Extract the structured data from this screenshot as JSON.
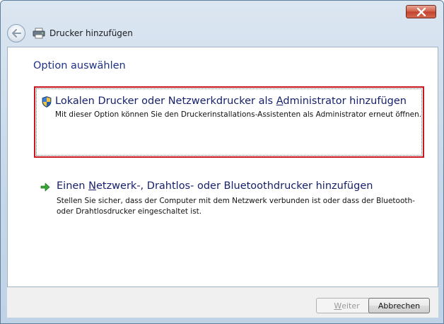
{
  "window": {
    "title": "Drucker hinzufügen"
  },
  "page": {
    "heading": "Option auswählen"
  },
  "options": [
    {
      "title_pre": "Lokalen Drucker oder Netzwerkdrucker als ",
      "title_accel": "A",
      "title_post": "dministrator hinzufügen",
      "description": "Mit dieser Option können Sie den Druckerinstallations-Assistenten als Administrator erneut öffnen.",
      "icon": "uac-shield-icon"
    },
    {
      "title_pre": "Einen ",
      "title_accel": "N",
      "title_post": "etzwerk-, Drahtlos- oder Bluetoothdrucker hinzufügen",
      "description": "Stellen Sie sicher, dass der Computer mit dem Netzwerk verbunden ist oder dass der Bluetooth- oder Drahtlosdrucker eingeschaltet ist.",
      "icon": "green-arrow-icon"
    }
  ],
  "buttons": {
    "next_accel": "W",
    "next_rest": "eiter",
    "cancel": "Abbrechen"
  },
  "colors": {
    "heading": "#1e3287",
    "selection_border": "#c8171f",
    "link_text": "#151f6b"
  }
}
